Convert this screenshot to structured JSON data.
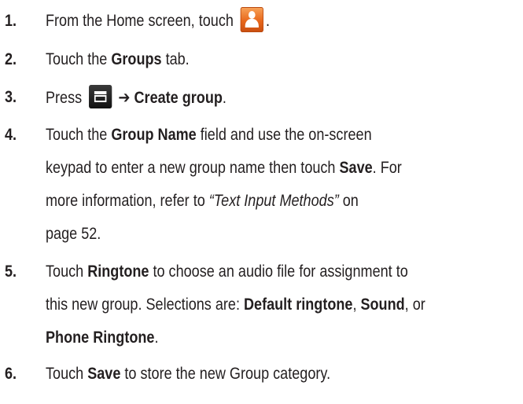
{
  "steps": [
    {
      "number": "1.",
      "lines": [
        {
          "pre": "From the Home screen, touch ",
          "post": "."
        }
      ],
      "icon": "contacts-icon"
    },
    {
      "number": "2.",
      "text_pre": "Touch the ",
      "bold": "Groups",
      "text_post": " tab."
    },
    {
      "number": "3.",
      "text_pre": "Press ",
      "icon": "menu-icon",
      "arrow": "➔",
      "bold": "Create group",
      "text_post": "."
    },
    {
      "number": "4.",
      "line1_pre": "Touch the ",
      "line1_bold": "Group Name",
      "line1_post": " field and use the on-screen",
      "line2_pre": "keypad to enter a new group name then touch ",
      "line2_bold": "Save",
      "line2_post": ". For",
      "line3_pre": "more information, refer to ",
      "line3_italic": "“Text Input Methods”",
      "line3_post": "  on",
      "line4": "page 52."
    },
    {
      "number": "5.",
      "line1_pre": "Touch ",
      "line1_bold": "Ringtone",
      "line1_post": " to choose an audio file for assignment to",
      "line2_pre": "this new group. Selections are: ",
      "line2_bold1": "Default ringtone",
      "line2_mid": ", ",
      "line2_bold2": "Sound",
      "line2_post": ", or",
      "line3_bold": "Phone Ringtone",
      "line3_post": "."
    },
    {
      "number": "6.",
      "text_pre": "Touch ",
      "bold": "Save",
      "text_post": " to store the new Group category."
    }
  ]
}
